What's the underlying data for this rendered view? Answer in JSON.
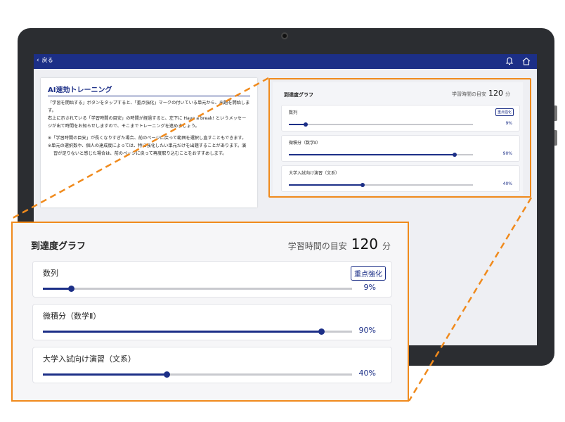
{
  "topbar": {
    "back_label": "戻る"
  },
  "lesson": {
    "title": "AI速効トレーニング",
    "paragraphs": [
      "「学習を開始する」ボタンをタップすると、「重点強化」マークの付いている単元から、出題を開始します。",
      "右上に示されている「学習時間の目安」の時間が経過すると、左下に Have a break! というメッセージが出て時間をお知らせしますので、そこまでトレーニングを進めましょう。"
    ],
    "notes": [
      "※「学習時間の目安」が長くなりすぎた場合、前のページに戻って範囲を選択し直すこともできます。",
      "※単元の選択数や、個人の達成度によっては、特に強化したい単元だけを出題することがあります。演習が足りないと感じた場合は、前のページに戻って再度取り込むことをおすすめします。"
    ]
  },
  "progress": {
    "title": "到達度グラフ",
    "study_time_label": "学習時間の目安",
    "study_time_value": "120",
    "study_time_unit": "分",
    "items": [
      {
        "name": "数列",
        "percent": 9,
        "percent_label": "9%",
        "badge": "重点強化"
      },
      {
        "name": "微積分（数学Ⅱ）",
        "percent": 90,
        "percent_label": "90%",
        "badge": ""
      },
      {
        "name": "大学入試向け演習（文系）",
        "percent": 40,
        "percent_label": "40%",
        "badge": ""
      }
    ]
  },
  "colors": {
    "accent": "#1c2f87",
    "highlight": "#f08a1c"
  }
}
